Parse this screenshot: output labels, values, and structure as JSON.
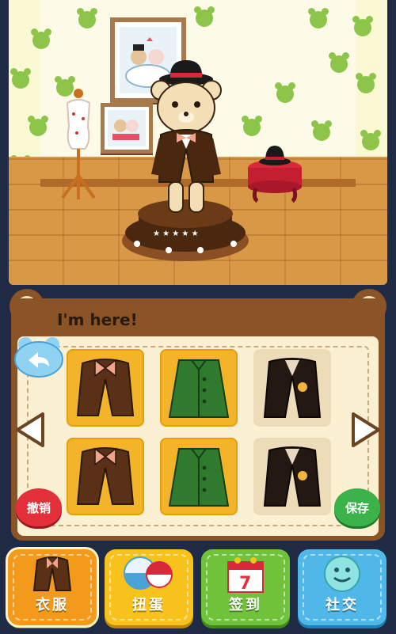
{
  "panel": {
    "title": "I'm here!"
  },
  "buttons": {
    "undo": "撤销",
    "save": "保存"
  },
  "tabs": [
    {
      "label": "衣服",
      "color": "#f39a1c"
    },
    {
      "label": "扭蛋",
      "color": "#f6c21b"
    },
    {
      "label": "签到",
      "color": "#6fc23a"
    },
    {
      "label": "社交",
      "color": "#4fb8e9"
    }
  ],
  "calendar_badge": "7",
  "closet": {
    "items": [
      {
        "kind": "brown-jacket-bowtie",
        "selected": true
      },
      {
        "kind": "green-coat",
        "selected": true
      },
      {
        "kind": "black-school-blazer",
        "selected": false
      },
      {
        "kind": "brown-jacket-bowtie",
        "selected": true
      },
      {
        "kind": "green-coat",
        "selected": true
      },
      {
        "kind": "black-school-blazer",
        "selected": false
      }
    ]
  },
  "icons": [
    "back-arrow-icon",
    "left-chevron-icon",
    "right-chevron-icon",
    "clothes-icon",
    "capsule-icon",
    "calendar-icon",
    "smiley-icon"
  ]
}
